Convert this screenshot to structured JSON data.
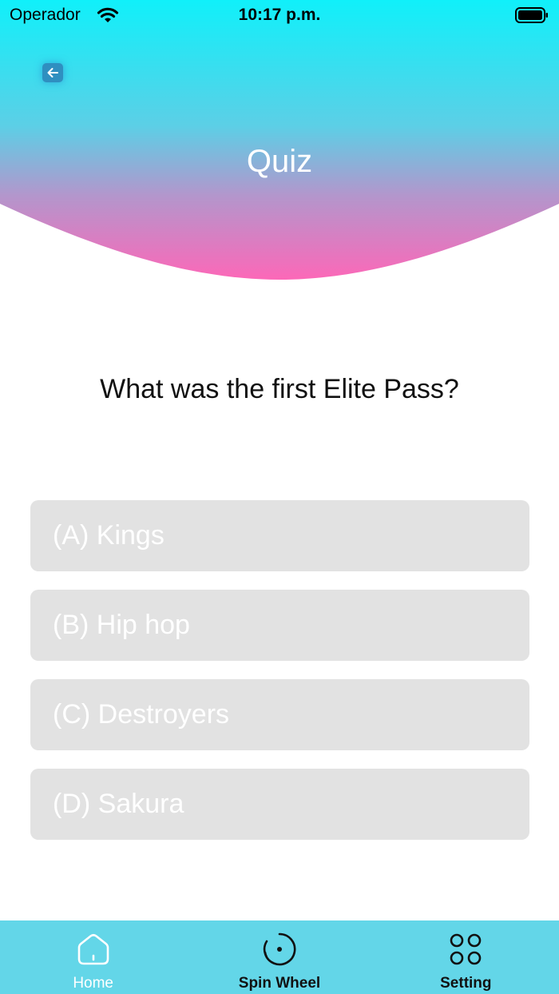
{
  "status_bar": {
    "carrier": "Operador",
    "time": "10:17 p.m."
  },
  "header": {
    "title": "Quiz",
    "gradient_top": "#10f0fa",
    "gradient_bottom": "#fc68b8"
  },
  "quiz": {
    "question": "What was the first Elite Pass?",
    "options": [
      {
        "label": "(A) Kings"
      },
      {
        "label": "(B) Hip hop"
      },
      {
        "label": "(C) Destroyers"
      },
      {
        "label": "(D) Sakura"
      }
    ]
  },
  "tab_bar": {
    "background": "#63d6e8",
    "tabs": [
      {
        "label": "Home",
        "icon": "home-icon",
        "active": true
      },
      {
        "label": "Spin Wheel",
        "icon": "spin-wheel-icon",
        "active": false
      },
      {
        "label": "Setting",
        "icon": "grid-icon",
        "active": false
      }
    ]
  }
}
